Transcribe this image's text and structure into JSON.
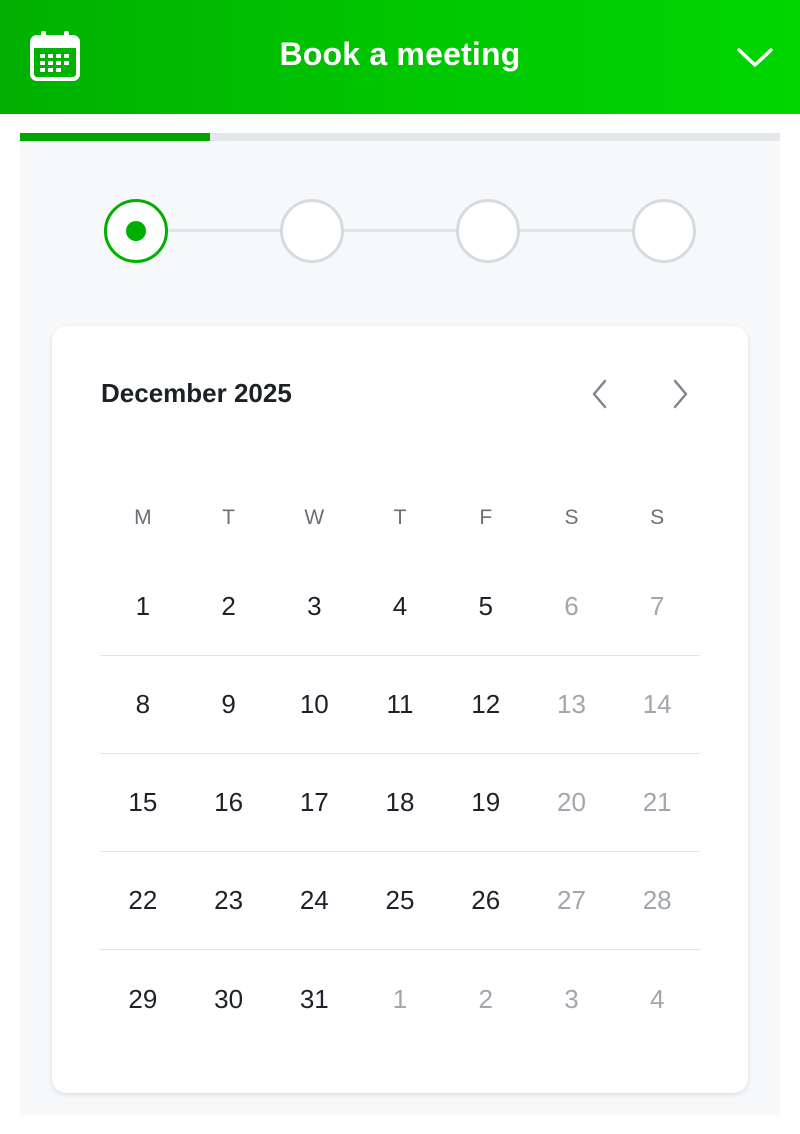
{
  "header": {
    "title": "Book a meeting",
    "icon": "calendar-icon",
    "collapse_icon": "chevron-down-icon",
    "background_start": "#00b000",
    "background_end": "#00d600"
  },
  "progress": {
    "fraction": 0.25,
    "fill_color": "#00a600",
    "track_color": "#e3e6ea"
  },
  "stepper": {
    "total_steps": 4,
    "active_step": 1,
    "active_color": "#00b000"
  },
  "calendar": {
    "month_label": "December 2025",
    "prev_icon": "chevron-left-icon",
    "next_icon": "chevron-right-icon",
    "weekdays": [
      "M",
      "T",
      "W",
      "T",
      "F",
      "S",
      "S"
    ],
    "weeks": [
      [
        {
          "d": "1",
          "muted": false
        },
        {
          "d": "2",
          "muted": false
        },
        {
          "d": "3",
          "muted": false
        },
        {
          "d": "4",
          "muted": false
        },
        {
          "d": "5",
          "muted": false
        },
        {
          "d": "6",
          "muted": true
        },
        {
          "d": "7",
          "muted": true
        }
      ],
      [
        {
          "d": "8",
          "muted": false
        },
        {
          "d": "9",
          "muted": false
        },
        {
          "d": "10",
          "muted": false
        },
        {
          "d": "11",
          "muted": false
        },
        {
          "d": "12",
          "muted": false
        },
        {
          "d": "13",
          "muted": true
        },
        {
          "d": "14",
          "muted": true
        }
      ],
      [
        {
          "d": "15",
          "muted": false
        },
        {
          "d": "16",
          "muted": false
        },
        {
          "d": "17",
          "muted": false
        },
        {
          "d": "18",
          "muted": false
        },
        {
          "d": "19",
          "muted": false
        },
        {
          "d": "20",
          "muted": true
        },
        {
          "d": "21",
          "muted": true
        }
      ],
      [
        {
          "d": "22",
          "muted": false
        },
        {
          "d": "23",
          "muted": false
        },
        {
          "d": "24",
          "muted": false
        },
        {
          "d": "25",
          "muted": false
        },
        {
          "d": "26",
          "muted": false
        },
        {
          "d": "27",
          "muted": true
        },
        {
          "d": "28",
          "muted": true
        }
      ],
      [
        {
          "d": "29",
          "muted": false
        },
        {
          "d": "30",
          "muted": false
        },
        {
          "d": "31",
          "muted": false
        },
        {
          "d": "1",
          "muted": true
        },
        {
          "d": "2",
          "muted": true
        },
        {
          "d": "3",
          "muted": true
        },
        {
          "d": "4",
          "muted": true
        }
      ]
    ]
  }
}
